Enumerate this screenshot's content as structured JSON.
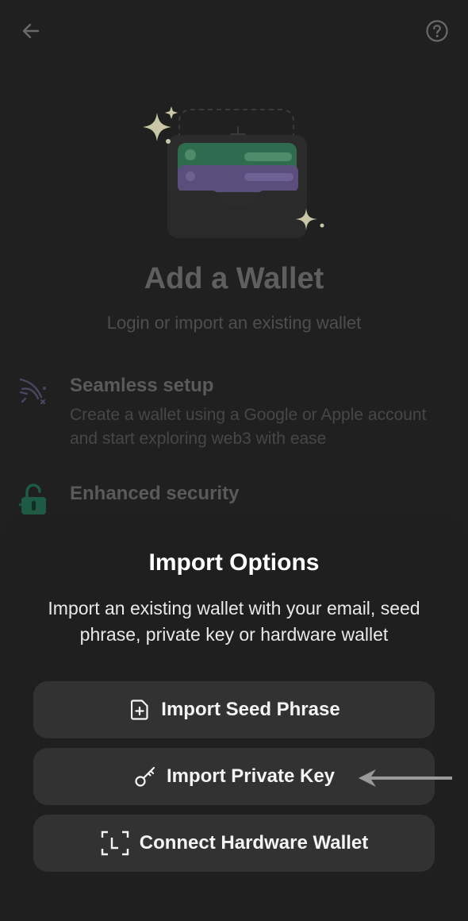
{
  "header": {
    "back_icon": "arrow-left-icon",
    "help_icon": "question-circle-icon"
  },
  "hero": {
    "illustration": "wallet-cards-icon",
    "title": "Add a Wallet",
    "subtitle": "Login or import an existing wallet"
  },
  "features": [
    {
      "icon": "sparkle-tool-icon",
      "title": "Seamless setup",
      "description": "Create a wallet using a Google or Apple account and start exploring web3 with ease"
    },
    {
      "icon": "padlock-icon",
      "title": "Enhanced security",
      "description": ""
    }
  ],
  "sheet": {
    "title": "Import Options",
    "description": "Import an existing wallet with your email, seed phrase, private key or hardware wallet",
    "options": [
      {
        "label": "Import Seed Phrase",
        "icon": "file-plus-icon"
      },
      {
        "label": "Import Private Key",
        "icon": "key-icon"
      },
      {
        "label": "Connect Hardware Wallet",
        "icon": "scan-frame-icon"
      }
    ]
  },
  "colors": {
    "background": "#202020",
    "sheet": "#1f1f1f",
    "button": "#323232",
    "wallet_green": "#2f6b4e",
    "wallet_purple": "#5a4e7c",
    "sparkle": "#c9c7a8",
    "annotation_arrow": "#9a9a9a"
  },
  "annotation": {
    "pointer_icon": "arrow-pointer-icon"
  }
}
